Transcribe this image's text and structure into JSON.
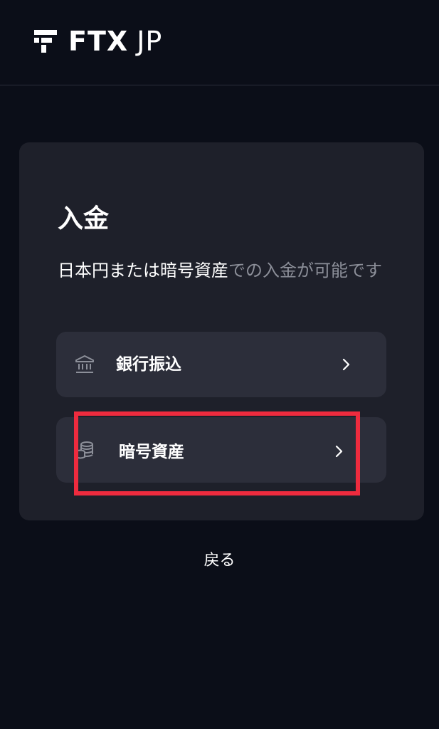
{
  "header": {
    "logo_brand": "FTX",
    "logo_region": "JP",
    "logo_icon": "ftx-logo-mark"
  },
  "deposit_card": {
    "title": "入金",
    "description_emphasis": "日本円または暗号資産",
    "description_rest": "での入金が可能です",
    "options": [
      {
        "label": "銀行振込",
        "icon": "bank-icon"
      },
      {
        "label": "暗号資産",
        "icon": "coins-icon"
      }
    ]
  },
  "back_label": "戻る",
  "colors": {
    "background": "#0b0e18",
    "card": "#1e202a",
    "option": "#2c2e3a",
    "muted_text": "#8c8f99",
    "highlight_border": "#ee2b3e"
  }
}
